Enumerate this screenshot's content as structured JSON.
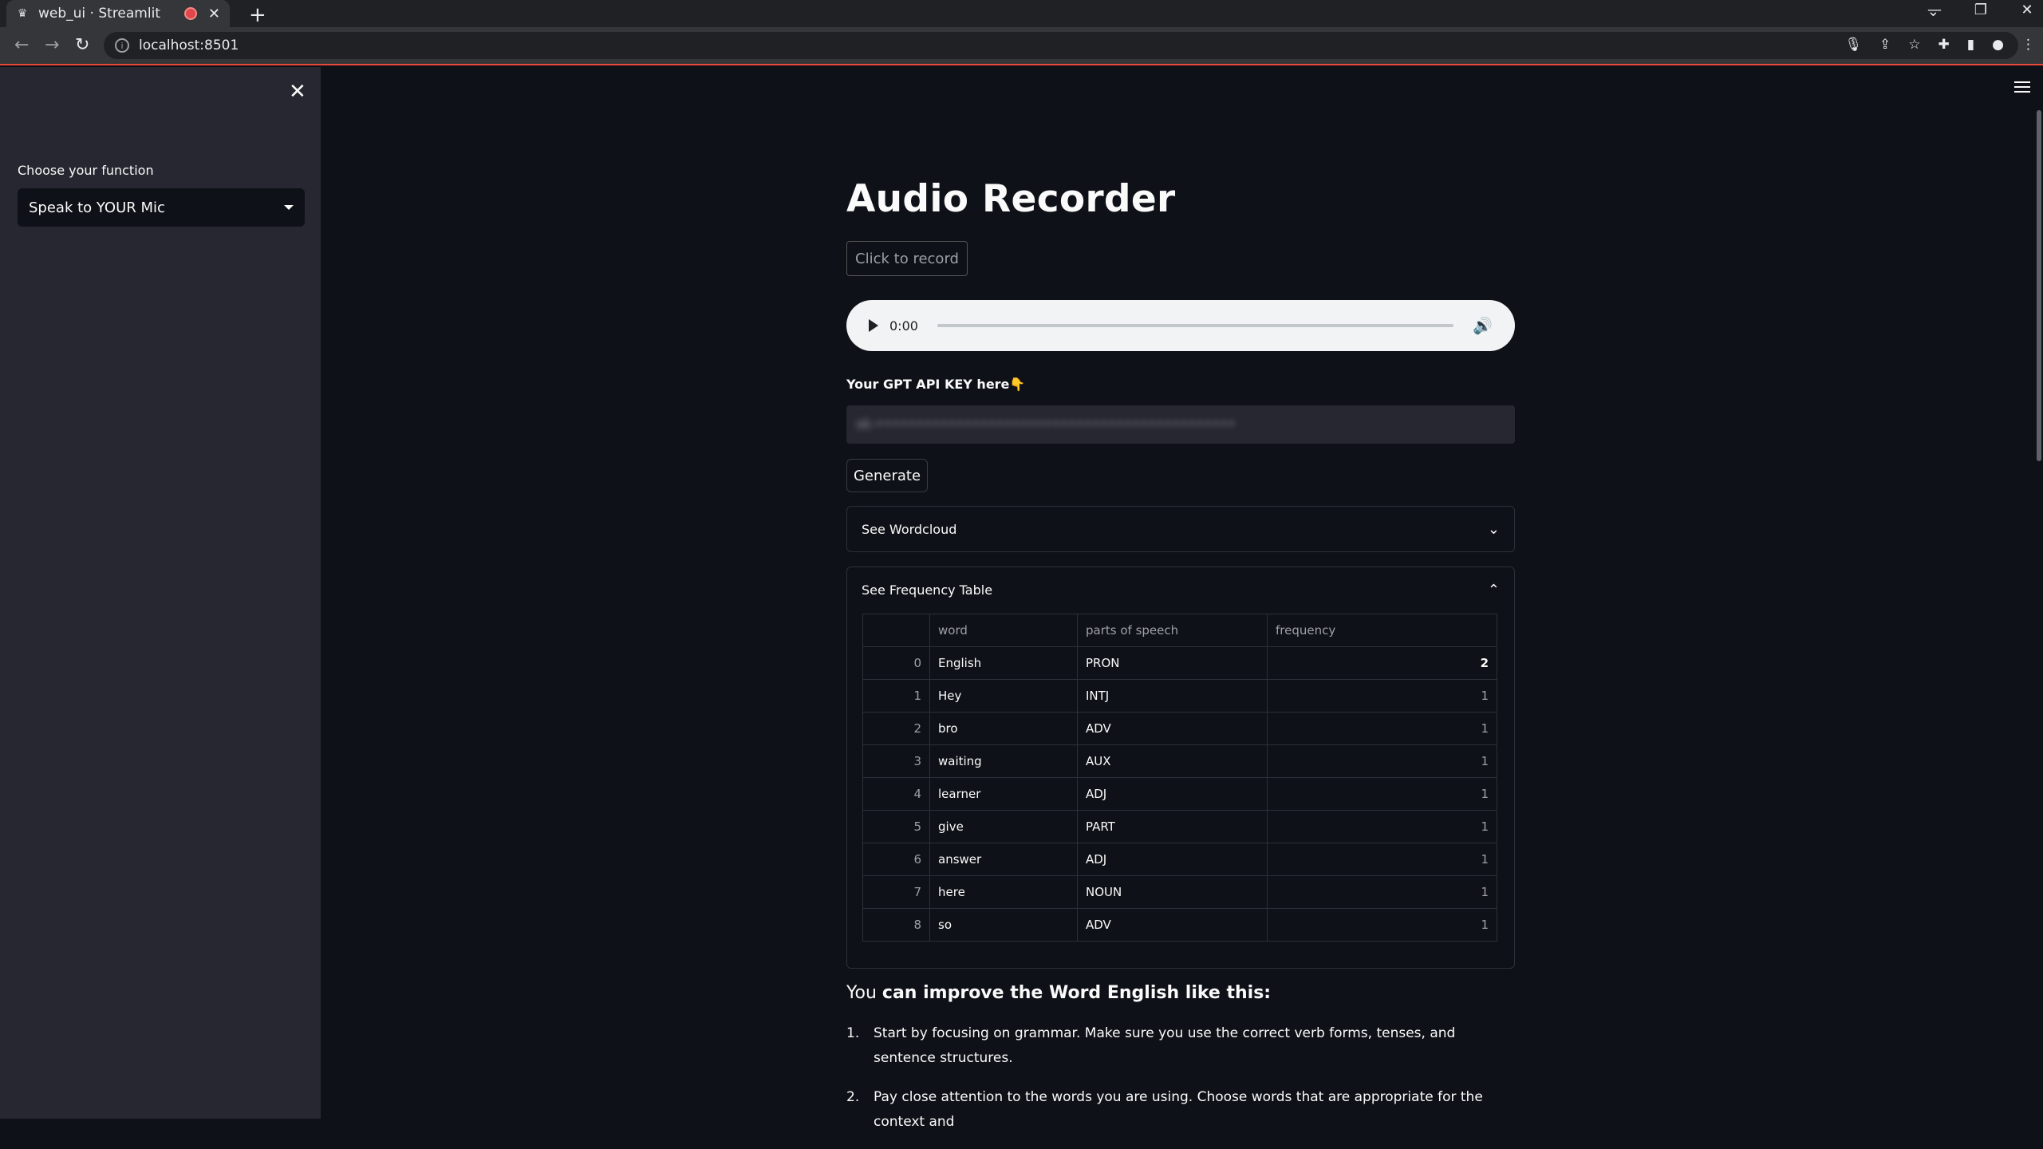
{
  "browser": {
    "tab_title": "web_ui · Streamlit",
    "url": "localhost:8501"
  },
  "sidebar": {
    "label": "Choose your function",
    "selected": "Speak to YOUR Mic"
  },
  "main": {
    "title": "Audio Recorder",
    "record_button": "Click to record",
    "audio_time": "0:00",
    "api_label": "Your GPT API KEY here👇",
    "api_value": "sk-•••••••••••••••••••••••••••••••••••••••••••••",
    "generate_button": "Generate",
    "wordcloud_expander": "See Wordcloud",
    "freq_expander": "See Frequency Table",
    "table": {
      "headers": [
        "",
        "word",
        "parts of speech",
        "frequency"
      ],
      "rows": [
        [
          "0",
          "English",
          "PRON",
          "2"
        ],
        [
          "1",
          "Hey",
          "INTJ",
          "1"
        ],
        [
          "2",
          "bro",
          "ADV",
          "1"
        ],
        [
          "3",
          "waiting",
          "AUX",
          "1"
        ],
        [
          "4",
          "learner",
          "ADJ",
          "1"
        ],
        [
          "5",
          "give",
          "PART",
          "1"
        ],
        [
          "6",
          "answer",
          "ADJ",
          "1"
        ],
        [
          "7",
          "here",
          "NOUN",
          "1"
        ],
        [
          "8",
          "so",
          "ADV",
          "1"
        ]
      ]
    },
    "improve_prefix": "You ",
    "improve_bold": "can improve the Word English like this:",
    "tips": [
      {
        "n": "1.",
        "text": "Start by focusing on grammar. Make sure you use the correct verb forms, tenses, and sentence structures."
      },
      {
        "n": "2.",
        "text": "Pay close attention to the words you are using. Choose words that are appropriate for the context and"
      }
    ]
  }
}
